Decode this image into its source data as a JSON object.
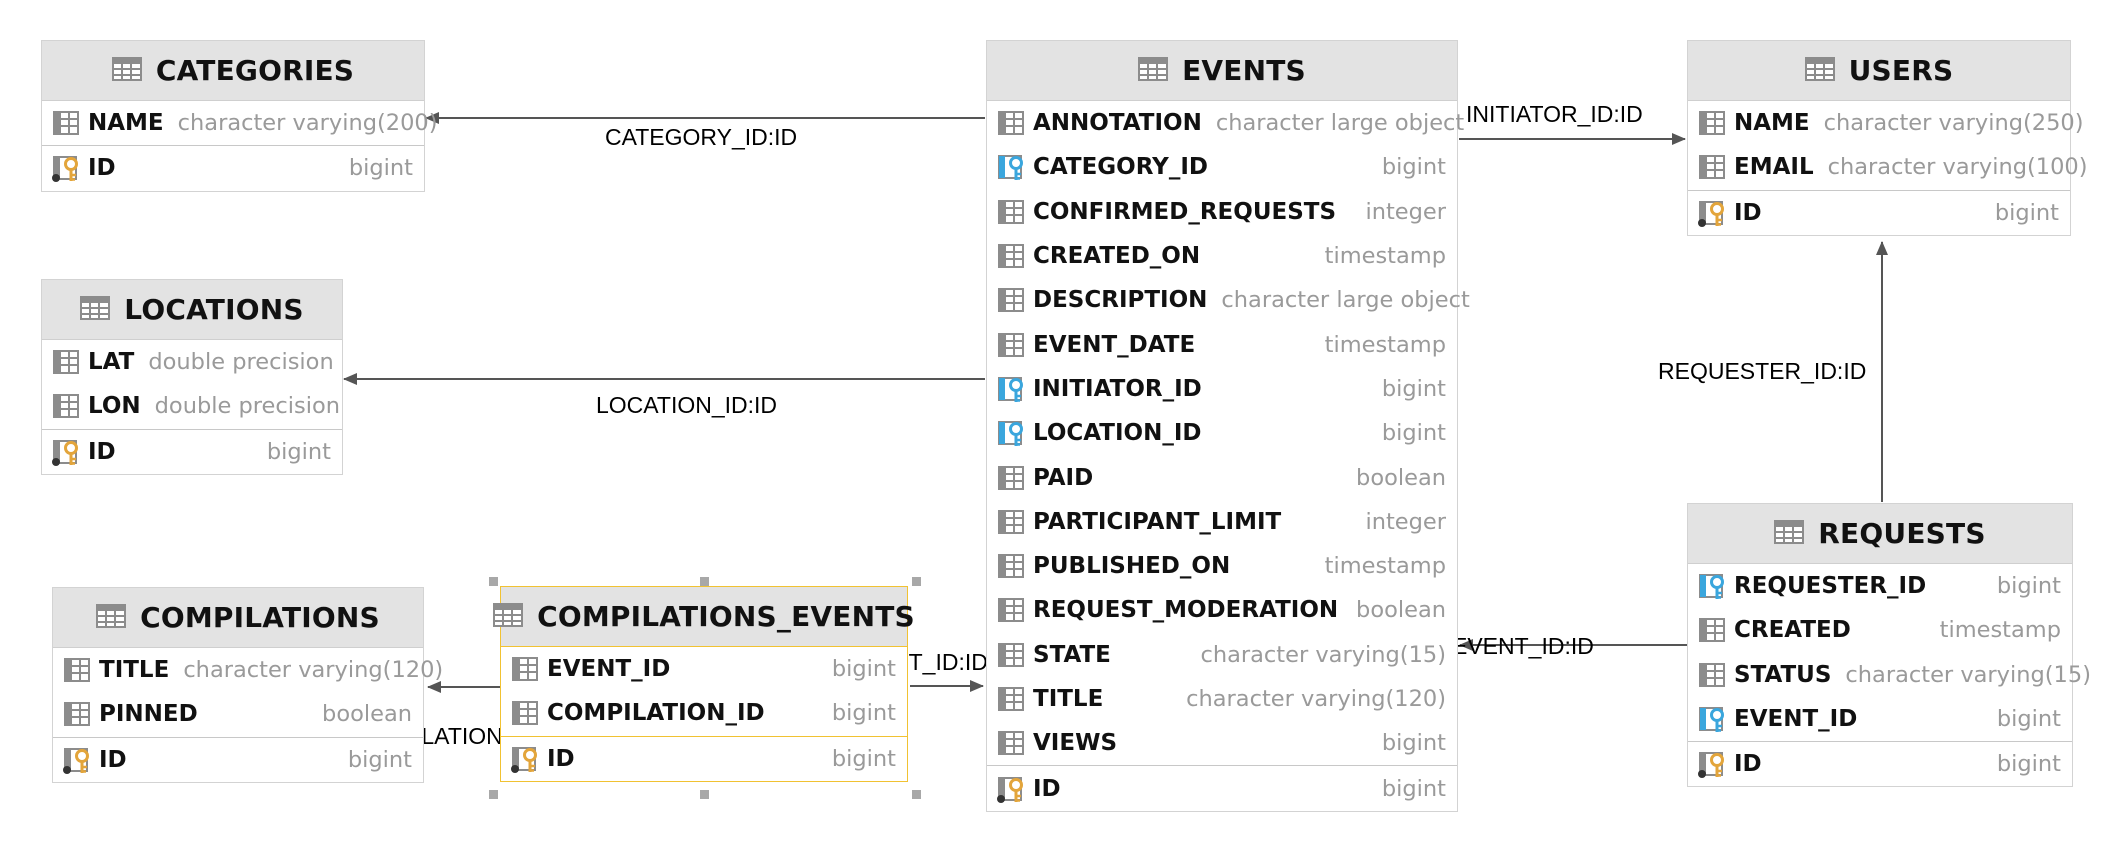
{
  "entities": [
    {
      "id": "categories",
      "title": "CATEGORIES",
      "columns": [
        {
          "name": "NAME",
          "type": "character varying(200)",
          "icon": "column-icon"
        }
      ],
      "keys": [
        {
          "name": "ID",
          "type": "bigint",
          "icon": "primary-key-icon"
        }
      ]
    },
    {
      "id": "locations",
      "title": "LOCATIONS",
      "columns": [
        {
          "name": "LAT",
          "type": "double precision",
          "icon": "column-icon"
        },
        {
          "name": "LON",
          "type": "double precision",
          "icon": "column-icon"
        }
      ],
      "keys": [
        {
          "name": "ID",
          "type": "bigint",
          "icon": "primary-key-icon"
        }
      ]
    },
    {
      "id": "compilations",
      "title": "COMPILATIONS",
      "columns": [
        {
          "name": "TITLE",
          "type": "character varying(120)",
          "icon": "column-icon"
        },
        {
          "name": "PINNED",
          "type": "boolean",
          "icon": "column-icon"
        }
      ],
      "keys": [
        {
          "name": "ID",
          "type": "bigint",
          "icon": "primary-key-icon"
        }
      ]
    },
    {
      "id": "compilations-events",
      "title": "COMPILATIONS_EVENTS",
      "selected": true,
      "columns": [
        {
          "name": "EVENT_ID",
          "type": "bigint",
          "icon": "column-icon"
        },
        {
          "name": "COMPILATION_ID",
          "type": "bigint",
          "icon": "column-icon"
        }
      ],
      "keys": [
        {
          "name": "ID",
          "type": "bigint",
          "icon": "primary-key-icon"
        }
      ]
    },
    {
      "id": "events",
      "title": "EVENTS",
      "columns": [
        {
          "name": "ANNOTATION",
          "type": "character large object",
          "icon": "column-icon"
        },
        {
          "name": "CATEGORY_ID",
          "type": "bigint",
          "icon": "foreign-key-icon"
        },
        {
          "name": "CONFIRMED_REQUESTS",
          "type": "integer",
          "icon": "column-icon"
        },
        {
          "name": "CREATED_ON",
          "type": "timestamp",
          "icon": "column-icon"
        },
        {
          "name": "DESCRIPTION",
          "type": "character large object",
          "icon": "column-icon"
        },
        {
          "name": "EVENT_DATE",
          "type": "timestamp",
          "icon": "column-icon"
        },
        {
          "name": "INITIATOR_ID",
          "type": "bigint",
          "icon": "foreign-key-icon"
        },
        {
          "name": "LOCATION_ID",
          "type": "bigint",
          "icon": "foreign-key-icon"
        },
        {
          "name": "PAID",
          "type": "boolean",
          "icon": "column-icon"
        },
        {
          "name": "PARTICIPANT_LIMIT",
          "type": "integer",
          "icon": "column-icon"
        },
        {
          "name": "PUBLISHED_ON",
          "type": "timestamp",
          "icon": "column-icon"
        },
        {
          "name": "REQUEST_MODERATION",
          "type": "boolean",
          "icon": "column-icon"
        },
        {
          "name": "STATE",
          "type": "character varying(15)",
          "icon": "column-icon"
        },
        {
          "name": "TITLE",
          "type": "character varying(120)",
          "icon": "column-icon"
        },
        {
          "name": "VIEWS",
          "type": "bigint",
          "icon": "column-icon"
        }
      ],
      "keys": [
        {
          "name": "ID",
          "type": "bigint",
          "icon": "primary-key-icon"
        }
      ]
    },
    {
      "id": "users",
      "title": "USERS",
      "columns": [
        {
          "name": "NAME",
          "type": "character varying(250)",
          "icon": "column-icon"
        },
        {
          "name": "EMAIL",
          "type": "character varying(100)",
          "icon": "column-icon"
        }
      ],
      "keys": [
        {
          "name": "ID",
          "type": "bigint",
          "icon": "primary-key-icon"
        }
      ]
    },
    {
      "id": "requests",
      "title": "REQUESTS",
      "columns": [
        {
          "name": "REQUESTER_ID",
          "type": "bigint",
          "icon": "foreign-key-icon"
        },
        {
          "name": "CREATED",
          "type": "timestamp",
          "icon": "column-icon"
        },
        {
          "name": "STATUS",
          "type": "character varying(15)",
          "icon": "column-icon"
        },
        {
          "name": "EVENT_ID",
          "type": "bigint",
          "icon": "foreign-key-icon"
        }
      ],
      "keys": [
        {
          "name": "ID",
          "type": "bigint",
          "icon": "primary-key-icon"
        }
      ]
    }
  ],
  "relations": [
    {
      "id": "rel-category",
      "label": "CATEGORY_ID:ID",
      "from": "events",
      "to": "categories"
    },
    {
      "id": "rel-location",
      "label": "LOCATION_ID:ID",
      "from": "events",
      "to": "locations"
    },
    {
      "id": "rel-initiator",
      "label": "INITIATOR_ID:ID",
      "from": "events",
      "to": "users"
    },
    {
      "id": "rel-requester",
      "label": "REQUESTER_ID:ID",
      "from": "requests",
      "to": "users"
    },
    {
      "id": "rel-request-event",
      "label": "EVENT_ID:ID",
      "from": "requests",
      "to": "events"
    },
    {
      "id": "rel-compilation-event",
      "label": "EVENT_ID:ID",
      "from": "compilations-events",
      "to": "events"
    },
    {
      "id": "rel-compilation",
      "label": "COMPILATION_ID:ID",
      "from": "compilations-events",
      "to": "compilations"
    }
  ],
  "colors": {
    "header": "#e3e3e3",
    "border": "#d3d3d3",
    "selection": "#f1c232",
    "column_icon": "#8c8c8c",
    "foreign_key": "#3aa6dd",
    "primary_key": "#e3a53b",
    "type_text": "#9a9a9a",
    "edge": "#555555"
  }
}
